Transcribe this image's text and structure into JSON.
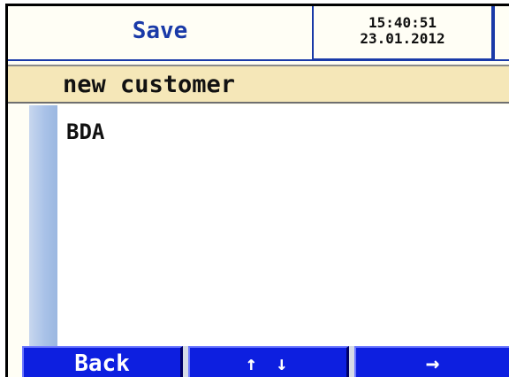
{
  "header": {
    "title": "Save",
    "time": "15:40:51",
    "date": "23.01.2012"
  },
  "list": {
    "selected": "new customer",
    "items": [
      "BDA"
    ]
  },
  "softkeys": {
    "back": "Back",
    "navigate": "↑ ↓",
    "next": "→"
  },
  "colors": {
    "accent": "#1a3aa8",
    "selection": "#f5e7b8",
    "softkey": "#0d1fe0",
    "background": "#fffef5"
  }
}
